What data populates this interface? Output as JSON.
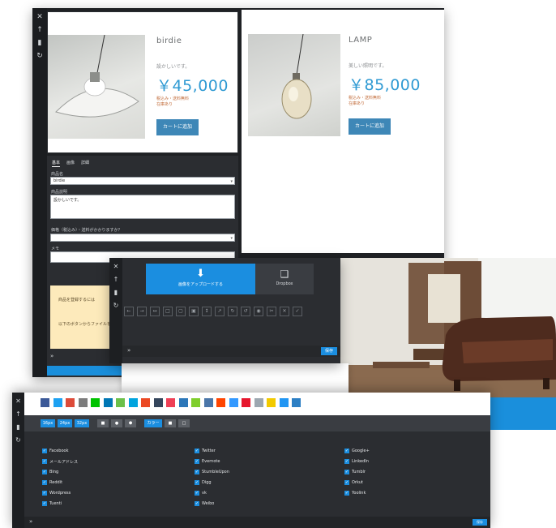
{
  "panel1": {
    "sidebar_icons": [
      "✕",
      "↑",
      "▮",
      "↻"
    ],
    "product1": {
      "name": "birdie",
      "desc": "設かしいです。",
      "price": "￥45,000",
      "meta1": "税込み・送料無料",
      "meta2": "在庫あり",
      "cart_button": "カートに追加"
    },
    "product2": {
      "name": "LAMP",
      "desc": "美しい照明です。",
      "price": "￥85,000",
      "meta1": "税込み・送料無料",
      "meta2": "在庫あり",
      "cart_button": "カートに追加"
    },
    "tabs": [
      "基本",
      "画像",
      "詳細"
    ],
    "fields": {
      "name_label": "商品名",
      "name_value": "birdie",
      "desc_label": "商品説明",
      "desc_value": "設かしいです。",
      "price_label": "価格（税込み）・送料がかかりますか？",
      "extra_label": "メモ"
    },
    "note_lines": [
      "商品を登録するには",
      "以下のボタンからファイルを"
    ],
    "close_icon": "»"
  },
  "panel2": {
    "sidebar_icons": [
      "✕",
      "↑",
      "▮",
      "↻"
    ],
    "upload_label": "画像をアップロードする",
    "upload_icon": "⬇",
    "dropbox_label": "Dropbox",
    "dropbox_icon": "❑",
    "tool_icons": [
      "←",
      "→",
      "↔",
      "□",
      "▢",
      "▣",
      "↕",
      "↗",
      "↻",
      "↺",
      "◉",
      "✂",
      "✕",
      "✓"
    ],
    "save_label": "保存",
    "close_icon": "»"
  },
  "panel3": {
    "sidebar_icons": [
      "✕",
      "↑",
      "▮",
      "↻"
    ],
    "social_icons": [
      {
        "name": "facebook-icon",
        "color": "#3b5998"
      },
      {
        "name": "twitter-icon",
        "color": "#1da1f2"
      },
      {
        "name": "googleplus-icon",
        "color": "#dd4b39"
      },
      {
        "name": "mail-icon",
        "color": "#7c7c7c"
      },
      {
        "name": "line-icon",
        "color": "#00c300"
      },
      {
        "name": "linkedin-icon",
        "color": "#0077b5"
      },
      {
        "name": "share-icon",
        "color": "#6cc04a"
      },
      {
        "name": "hatena-icon",
        "color": "#00a4de"
      },
      {
        "name": "stumbleupon-icon",
        "color": "#eb4924"
      },
      {
        "name": "tumblr-icon",
        "color": "#35465c"
      },
      {
        "name": "pocket-icon",
        "color": "#ef4056"
      },
      {
        "name": "digg-icon",
        "color": "#2c77b9"
      },
      {
        "name": "evernote-icon",
        "color": "#7fce2c"
      },
      {
        "name": "vk-icon",
        "color": "#4a76a8"
      },
      {
        "name": "reddit-icon",
        "color": "#ff4500"
      },
      {
        "name": "delicious-icon",
        "color": "#3399ff"
      },
      {
        "name": "weibo-icon",
        "color": "#e6162d"
      },
      {
        "name": "print-icon",
        "color": "#9ca7b0"
      },
      {
        "name": "yahoo-icon",
        "color": "#f2ca00"
      },
      {
        "name": "gmail-icon",
        "color": "#2196f3"
      },
      {
        "name": "rss-icon",
        "color": "#2c7fc4"
      }
    ],
    "bar_buttons": [
      {
        "label": "16px",
        "style": "blue"
      },
      {
        "label": "24px",
        "style": "blue"
      },
      {
        "label": "32px",
        "style": "blue"
      },
      {
        "label": "■",
        "style": "grey"
      },
      {
        "label": "●",
        "style": "grey"
      },
      {
        "label": "⬢",
        "style": "grey"
      },
      {
        "label": "カラー",
        "style": "blue"
      },
      {
        "label": "■",
        "style": "grey"
      },
      {
        "label": "□",
        "style": "grey"
      }
    ],
    "col1": [
      "Facebook",
      "メールアドレス",
      "Bing",
      "Reddit",
      "Wordpress",
      "Tuenti"
    ],
    "col2": [
      "Twitter",
      "Evernote",
      "StumbleUpon",
      "Digg",
      "vk",
      "Weibo"
    ],
    "col3": [
      "Google+",
      "LinkedIn",
      "Tumblr",
      "Orkut",
      "Yoolink"
    ],
    "save_label": "保存",
    "close_icon": "»"
  }
}
